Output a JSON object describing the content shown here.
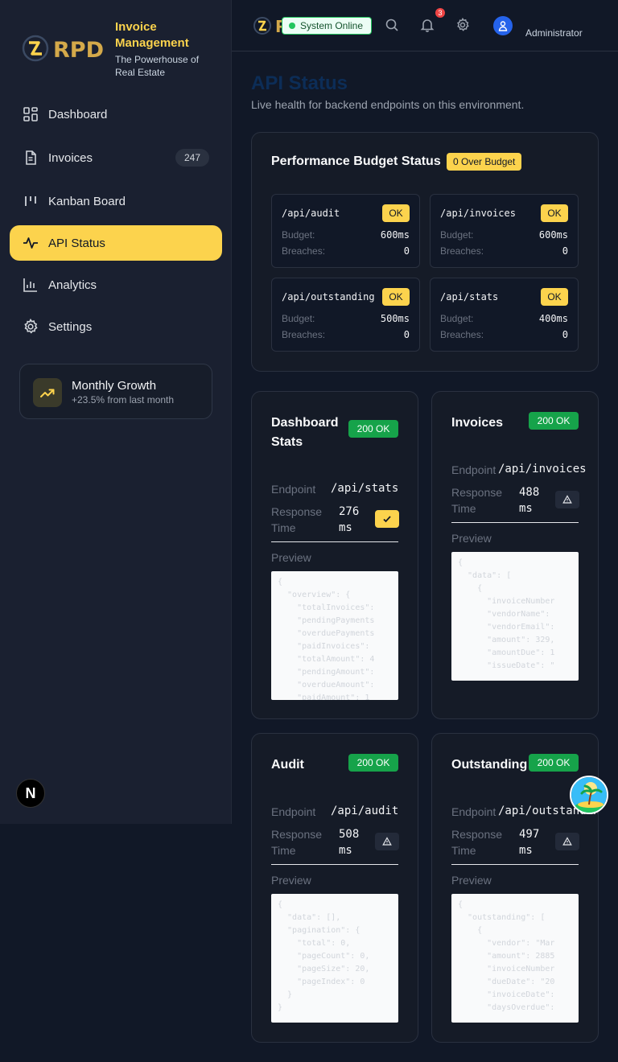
{
  "brand": {
    "logo_text": "RPD",
    "title": "Invoice Management",
    "subtitle": "The Powerhouse of Real Estate"
  },
  "sidebar": {
    "items": [
      {
        "label": "Dashboard",
        "icon": "dashboard-icon"
      },
      {
        "label": "Invoices",
        "icon": "file-icon",
        "badge": "247"
      },
      {
        "label": "Kanban Board",
        "icon": "kanban-icon"
      },
      {
        "label": "API Status",
        "icon": "activity-icon",
        "active": true
      },
      {
        "label": "Analytics",
        "icon": "bar-chart-icon"
      },
      {
        "label": "Settings",
        "icon": "gear-icon"
      }
    ],
    "growth": {
      "title": "Monthly Growth",
      "subtitle": "+23.5% from last month"
    },
    "next_badge": "N"
  },
  "header": {
    "status": "System Online",
    "notification_count": "3",
    "user": "Administrator"
  },
  "page": {
    "title": "API Status",
    "subtitle": "Live health for backend endpoints on this environment."
  },
  "budget": {
    "title": "Performance Budget Status",
    "badge": "0 Over Budget",
    "budget_label": "Budget:",
    "breaches_label": "Breaches:",
    "items": [
      {
        "endpoint": "/api/audit",
        "status": "OK",
        "budget": "600ms",
        "breaches": "0"
      },
      {
        "endpoint": "/api/invoices",
        "status": "OK",
        "budget": "600ms",
        "breaches": "0"
      },
      {
        "endpoint": "/api/outstanding",
        "status": "OK",
        "budget": "500ms",
        "breaches": "0"
      },
      {
        "endpoint": "/api/stats",
        "status": "OK",
        "budget": "400ms",
        "breaches": "0"
      }
    ]
  },
  "labels": {
    "endpoint": "Endpoint",
    "response_time": "Response Time",
    "preview": "Preview"
  },
  "endpoints": [
    {
      "title": "Dashboard Stats",
      "code": "200 OK",
      "endpoint": "/api/stats",
      "response": "276 ms",
      "flag": "check",
      "preview": "{\n  \"overview\": {\n    \"totalInvoices\":\n    \"pendingPayments\n    \"overduePayments\n    \"paidInvoices\":\n    \"totalAmount\": 4\n    \"pendingAmount\":\n    \"overdueAmount\":\n    \"paidAmount\": 1"
    },
    {
      "title": "Invoices",
      "code": "200 OK",
      "endpoint": "/api/invoices",
      "response": "488 ms",
      "flag": "warning",
      "preview": "{\n  \"data\": [\n    {\n      \"invoiceNumber\n      \"vendorName\":\n      \"vendorEmail\":\n      \"amount\": 329,\n      \"amountDue\": 1\n      \"issueDate\": \""
    },
    {
      "title": "Audit",
      "code": "200 OK",
      "endpoint": "/api/audit",
      "response": "508 ms",
      "flag": "warning",
      "preview": "{\n  \"data\": [],\n  \"pagination\": {\n    \"total\": 0,\n    \"pageCount\": 0,\n    \"pageSize\": 20,\n    \"pageIndex\": 0\n  }\n}"
    },
    {
      "title": "Outstanding",
      "code": "200 OK",
      "endpoint": "/api/outstanding",
      "response": "497 ms",
      "flag": "warning",
      "preview": "{\n  \"outstanding\": [\n    {\n      \"vendor\": \"Mar\n      \"amount\": 2885\n      \"invoiceNumber\n      \"dueDate\": \"20\n      \"invoiceDate\":\n      \"daysOverdue\":"
    }
  ]
}
